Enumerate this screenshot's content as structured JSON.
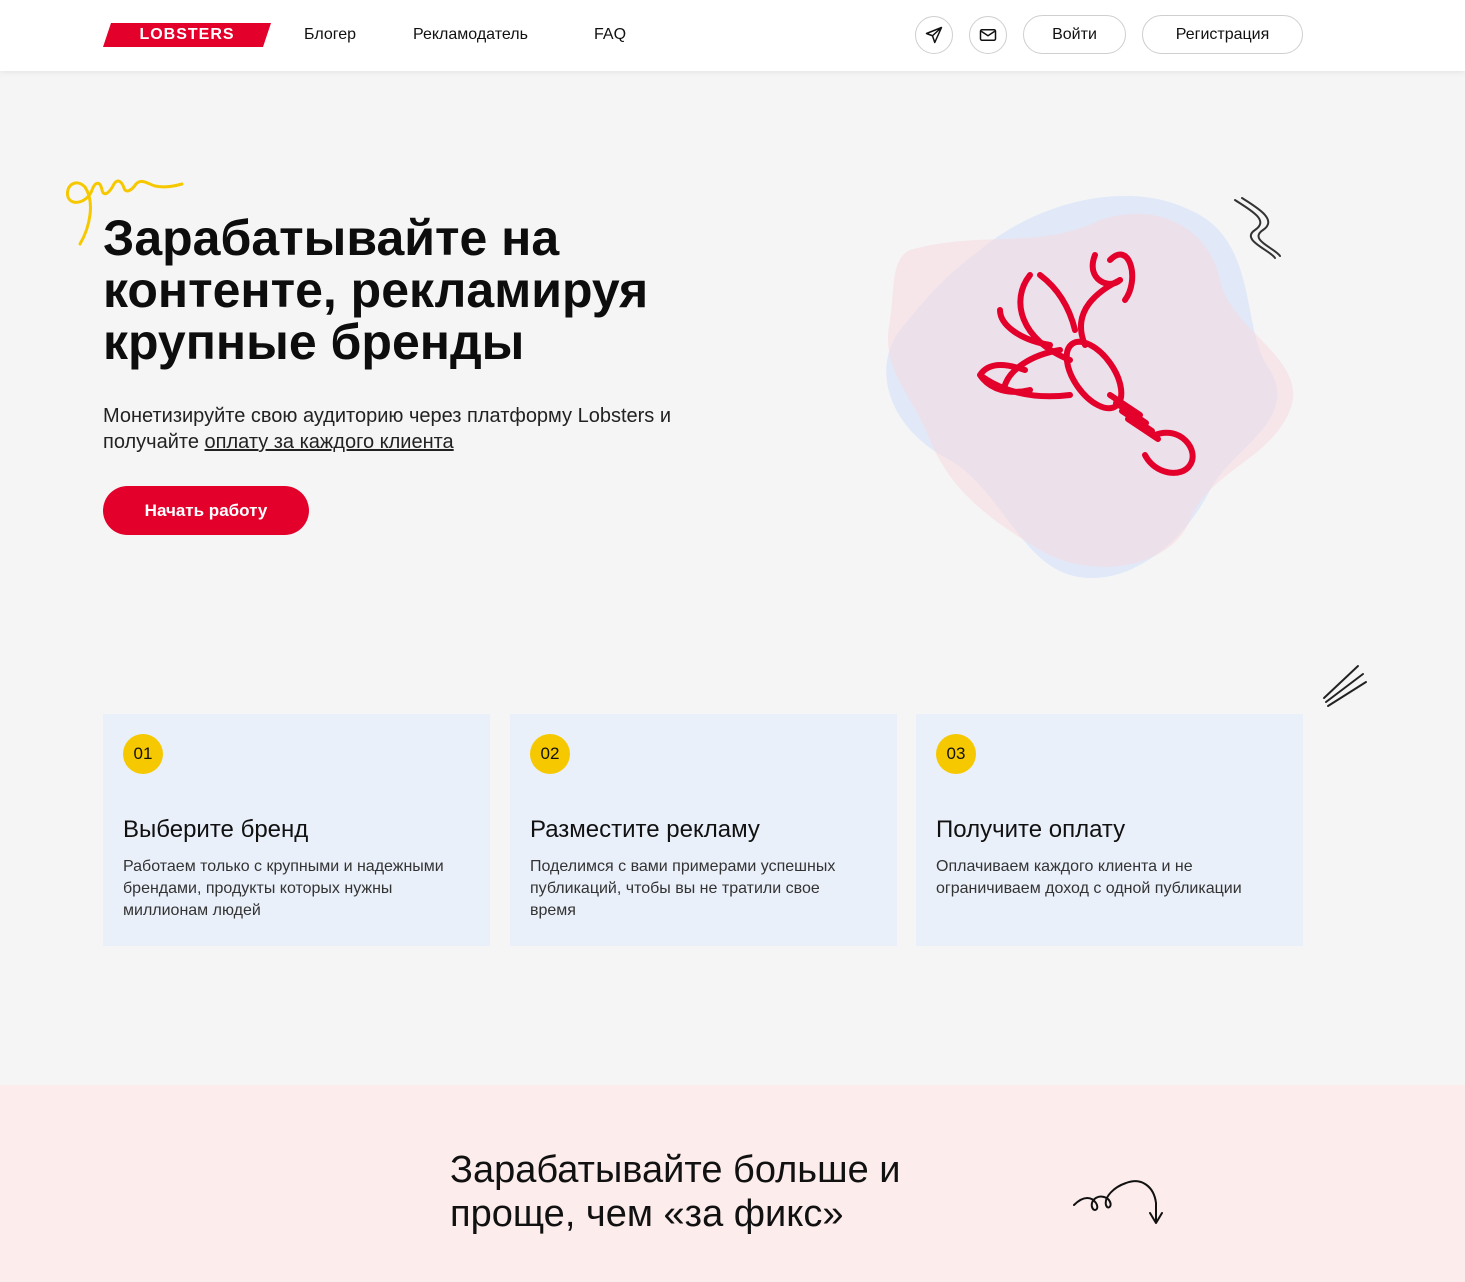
{
  "header": {
    "logo_text": "LOBSTERS",
    "nav": [
      "Блогер",
      "Рекламодатель",
      "FAQ"
    ],
    "login_label": "Войти",
    "register_label": "Регистрация"
  },
  "hero": {
    "title": "Зарабатывайте на контенте, рекламируя крупные бренды",
    "subtitle_prefix": "Монетизируйте свою аудиторию через платформу Lobsters и получайте ",
    "subtitle_link": "оплату за каждого клиента",
    "cta_label": "Начать работу"
  },
  "steps": [
    {
      "num": "01",
      "title": "Выберите бренд",
      "text": "Работаем только с крупными и надежными брендами, продукты которых нужны миллионам людей"
    },
    {
      "num": "02",
      "title": "Разместите рекламу",
      "text": "Поделимся с вами примерами успешных публикаций, чтобы вы не тратили свое время"
    },
    {
      "num": "03",
      "title": "Получите оплату",
      "text": "Оплачиваем каждого клиента и не ограничиваем доход с одной публикации"
    }
  ],
  "bottom": {
    "title": "Зарабатывайте больше и проще, чем «за фикс»"
  },
  "colors": {
    "accent": "#e3002b",
    "badge": "#f6c800",
    "card_bg": "#eaf0fa",
    "pink_section": "#fcecec"
  }
}
